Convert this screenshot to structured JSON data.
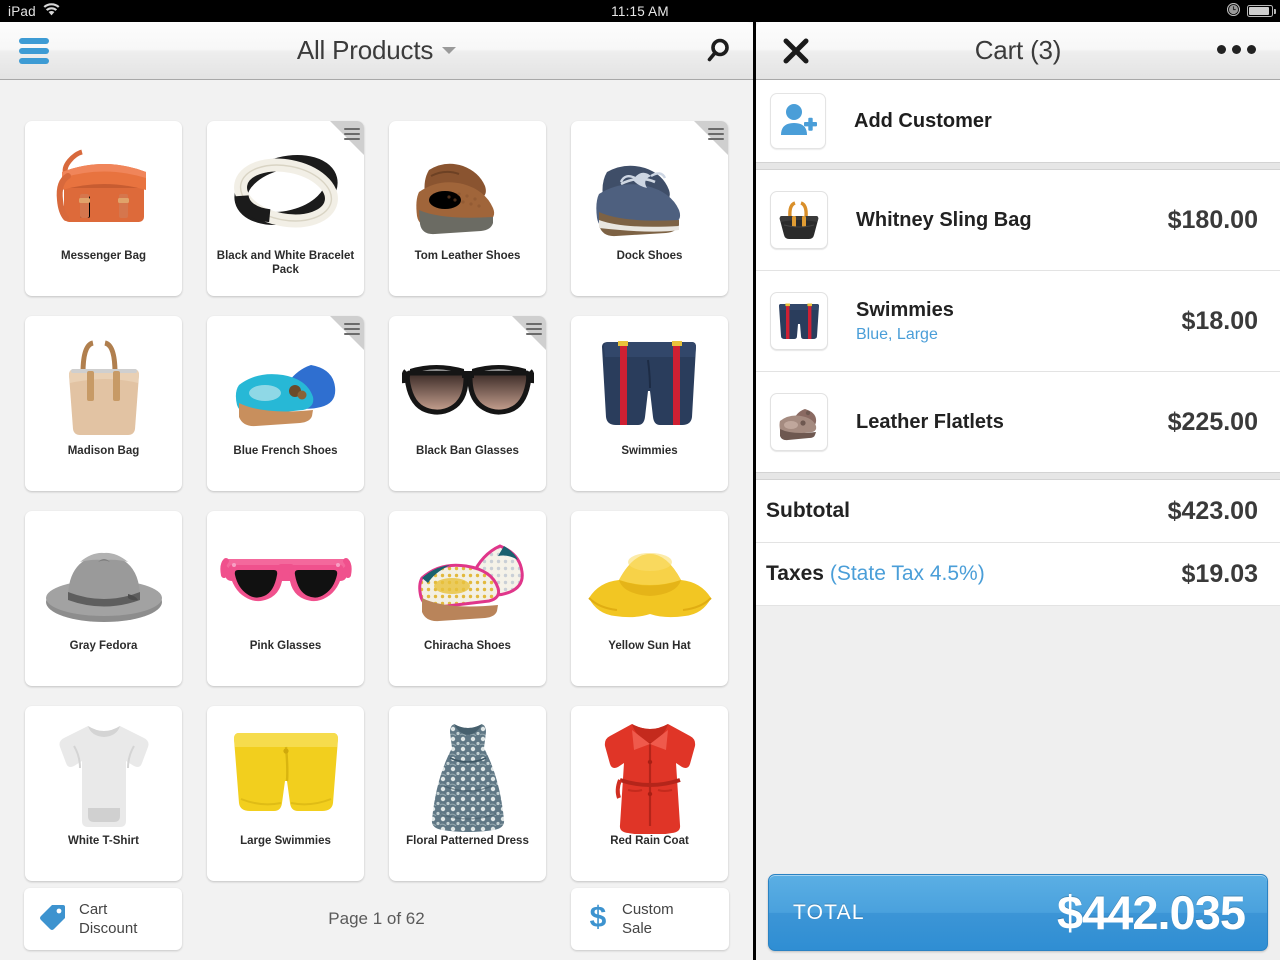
{
  "status_bar": {
    "device": "iPad",
    "wifi_icon": "wifi-icon",
    "time": "11:15 AM",
    "clock_icon": "clock-icon",
    "battery_icon": "battery-icon"
  },
  "left_panel": {
    "menu_icon": "hamburger-menu-icon",
    "title": "All Products",
    "dropdown_icon": "chevron-down-icon",
    "search_icon": "search-icon",
    "products": [
      {
        "name": "Messenger Bag",
        "image": "orange-messenger-bag",
        "has_variants": false
      },
      {
        "name": "Black and White Bracelet Pack",
        "image": "black-white-bracelets",
        "has_variants": true
      },
      {
        "name": "Tom Leather Shoes",
        "image": "brown-leather-loafers",
        "has_variants": false
      },
      {
        "name": "Dock Shoes",
        "image": "blue-boat-shoes",
        "has_variants": true
      },
      {
        "name": "Madison Bag",
        "image": "tan-tote-bag",
        "has_variants": false
      },
      {
        "name": "Blue French Shoes",
        "image": "blue-flats",
        "has_variants": true
      },
      {
        "name": "Black Ban Glasses",
        "image": "black-sunglasses",
        "has_variants": true
      },
      {
        "name": "Swimmies",
        "image": "navy-swim-shorts",
        "has_variants": false
      },
      {
        "name": "Gray Fedora",
        "image": "gray-fedora-hat",
        "has_variants": false
      },
      {
        "name": "Pink Glasses",
        "image": "pink-sunglasses",
        "has_variants": false
      },
      {
        "name": "Chiracha Shoes",
        "image": "patterned-flats",
        "has_variants": false
      },
      {
        "name": "Yellow Sun Hat",
        "image": "yellow-sun-hat",
        "has_variants": false
      },
      {
        "name": "White T-Shirt",
        "image": "white-tshirt",
        "has_variants": false
      },
      {
        "name": "Large Swimmies",
        "image": "yellow-shorts",
        "has_variants": false
      },
      {
        "name": "Floral Patterned Dress",
        "image": "floral-dress",
        "has_variants": false
      },
      {
        "name": "Red Rain Coat",
        "image": "red-rain-coat",
        "has_variants": false
      }
    ],
    "footer": {
      "cart_discount_label": "Cart\nDiscount",
      "cart_discount_line1": "Cart",
      "cart_discount_line2": "Discount",
      "cart_discount_icon": "price-tag-icon",
      "page_indicator": "Page 1 of 62",
      "custom_sale_line1": "Custom",
      "custom_sale_line2": "Sale",
      "custom_sale_icon": "dollar-sign-icon"
    }
  },
  "right_panel": {
    "close_icon": "close-x-icon",
    "title": "Cart (3)",
    "more_icon": "ellipsis-icon",
    "add_customer": {
      "label": "Add Customer",
      "icon": "add-person-icon"
    },
    "items": [
      {
        "name": "Whitney Sling Bag",
        "variant": "",
        "price": "$180.00",
        "image": "black-sling-bag"
      },
      {
        "name": "Swimmies",
        "variant": "Blue, Large",
        "price": "$18.00",
        "image": "navy-swim-shorts"
      },
      {
        "name": "Leather Flatlets",
        "variant": "",
        "price": "$225.00",
        "image": "brown-flats"
      }
    ],
    "totals": [
      {
        "label": "Subtotal",
        "sublabel": "",
        "value": "$423.00"
      },
      {
        "label": "Taxes",
        "sublabel": "(State Tax 4.5%)",
        "value": "$19.03"
      }
    ],
    "total_bar": {
      "label": "TOTAL",
      "value": "$442.035"
    }
  },
  "colors": {
    "accent_blue": "#3d9bd4",
    "link_blue": "#4a9ed8",
    "total_bar_blue": "#4aa1dd",
    "panel_bg": "#f2f2f2"
  }
}
